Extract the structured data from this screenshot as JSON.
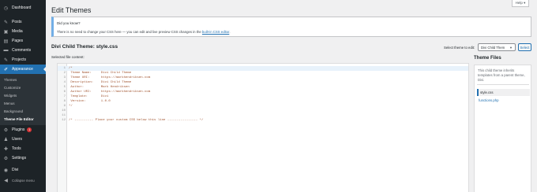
{
  "sidebar": {
    "items": [
      {
        "label": "Dashboard",
        "icon": "dashboard-icon",
        "glyph": "◷"
      },
      {
        "label": "Posts",
        "icon": "pin-icon",
        "glyph": "✎"
      },
      {
        "label": "Media",
        "icon": "media-icon",
        "glyph": "▣"
      },
      {
        "label": "Pages",
        "icon": "page-icon",
        "glyph": "▤"
      },
      {
        "label": "Comments",
        "icon": "comment-icon",
        "glyph": "▬"
      },
      {
        "label": "Projects",
        "icon": "projects-icon",
        "glyph": "✎"
      },
      {
        "label": "Appearance",
        "icon": "brush-icon",
        "glyph": "✐"
      }
    ],
    "submenu": [
      "Themes",
      "Customize",
      "Widgets",
      "Menus",
      "Background",
      "Theme File Editor"
    ],
    "items_after": [
      {
        "label": "Plugins",
        "icon": "plugin-icon",
        "glyph": "⚙",
        "badge": "1"
      },
      {
        "label": "Users",
        "icon": "users-icon",
        "glyph": "♟"
      },
      {
        "label": "Tools",
        "icon": "tools-icon",
        "glyph": "✚"
      },
      {
        "label": "Settings",
        "icon": "settings-icon",
        "glyph": "⚙"
      },
      {
        "label": "Divi",
        "icon": "divi-icon",
        "glyph": "◉"
      },
      {
        "label": "Collapse menu",
        "icon": "collapse-icon",
        "glyph": "◀"
      }
    ]
  },
  "help_label": "Help ▾",
  "page_title": "Edit Themes",
  "notice": {
    "title": "Did you know?",
    "text_before": "There is no need to change your CSS here — you can edit and live preview CSS changes in the ",
    "link": "built-in CSS editor",
    "text_after": "."
  },
  "file_heading": "Divi Child Theme: style.css",
  "selected_label": "Selected file content:",
  "select_label": "Select theme to edit:",
  "select_value": "Divi Child Them",
  "select_button": "Select",
  "code_lines": [
    "/*",
    " Theme Name:     Divi Child Theme",
    " Theme URI:      https://markhendriksen.com",
    " Description:    Divi Child Theme",
    " Author:         Mark Hendriksen",
    " Author URI:     https://markhendriksen.com",
    " Template:       Divi",
    " Version:        1.0.0",
    "*/",
    "",
    "",
    "/* ---------- Place your custom CSS below this line ---------------- */"
  ],
  "files_heading": "Theme Files",
  "files_desc": "This child theme inherits templates from a parent theme, Divi.",
  "files": [
    "style.css",
    "functions.php"
  ],
  "colors": {
    "sidebar": "#1d2327",
    "accent": "#2271b1",
    "notice_border": "#72aee6"
  }
}
